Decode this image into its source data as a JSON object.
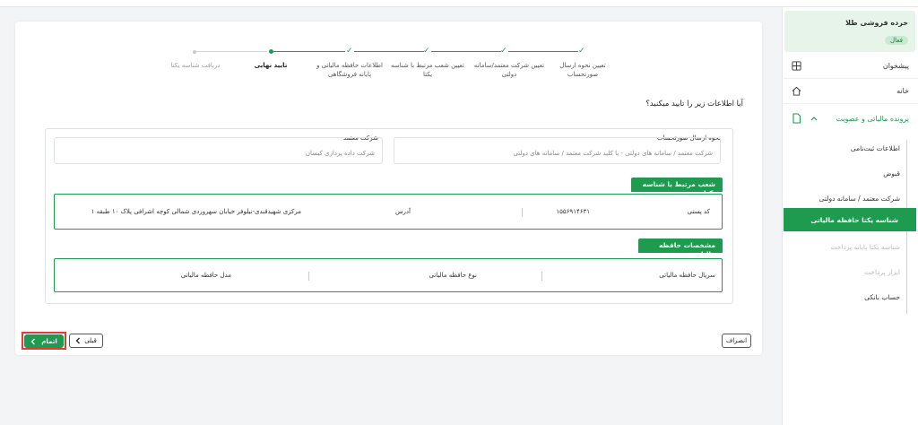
{
  "sidebar": {
    "shop_name": "خرده فروشی طلا",
    "shop_status": "فعال",
    "items": [
      {
        "label": "پیشخوان",
        "icon": "dashboard-icon"
      },
      {
        "label": "خانه",
        "icon": "home-icon"
      },
      {
        "label": "پرونده مالیاتی و عضویت",
        "icon": "document-icon"
      }
    ],
    "submenu": [
      {
        "label": "اطلاعات ثبت‌نامی",
        "state": "normal"
      },
      {
        "label": "قبوض",
        "state": "normal"
      },
      {
        "label": "شرکت معتمد / سامانه دولتی",
        "state": "normal"
      },
      {
        "label": "شناسه یکتا حافظه مالیاتی",
        "state": "active"
      },
      {
        "label": "شناسه یکتا پایانه پرداخت",
        "state": "disabled"
      },
      {
        "label": "ابزار پرداخت",
        "state": "disabled"
      },
      {
        "label": "حساب بانکی",
        "state": "normal"
      }
    ]
  },
  "stepper": {
    "steps": [
      {
        "label": "تعیین نحوه ارسال صورتحساب",
        "status": "done"
      },
      {
        "label": "تعیین شرکت معتمد/سامانه دولتی",
        "status": "done"
      },
      {
        "label": "تعیین شعب مرتبط با شناسه یکتا",
        "status": "done"
      },
      {
        "label": "اطلاعات حافظه مالیاتی و پایانه فروشگاهی",
        "status": "done"
      },
      {
        "label": "تایید نهایی",
        "status": "current"
      },
      {
        "label": "دریافت شناسه یکتا",
        "status": "pending"
      }
    ]
  },
  "question": "آیا اطلاعات زیر را تایید میکنید؟",
  "form": {
    "send_method_label": "نحوه ارسال صورتحساب",
    "send_method_value": "شرکت معتمد / سامانه های دولتی - با کلید شرکت معتمد / سامانه های دولتی",
    "trusted_company_label": "شرکت معتمد",
    "trusted_company_value": "شرکت داده پردازی کیسان"
  },
  "branches": {
    "title": "شعب مرتبط با شناسه یکتا",
    "postal_code_label": "کد پستی",
    "postal_code_value": "۱۵۵۶۹۱۴۶۳۱",
    "address_label": "آدرس",
    "address_value": "مرکزی شهیدقندی-نیلوفر خیابان سهروردی شمالی کوچه اشرافی پلاک ۱۰ طبقه ۱"
  },
  "memory": {
    "title": "مشخصات حافظه مالیاتی",
    "serial_label": "سریال حافظه مالیاتی",
    "type_label": "نوع حافظه مالیاتی",
    "model_label": "مدل حافظه مالیاتی"
  },
  "buttons": {
    "cancel": "انصراف",
    "prev": "قبلی",
    "finish": "اتمام"
  },
  "colors": {
    "primary": "#1e9b4f",
    "highlight": "#e53935"
  }
}
